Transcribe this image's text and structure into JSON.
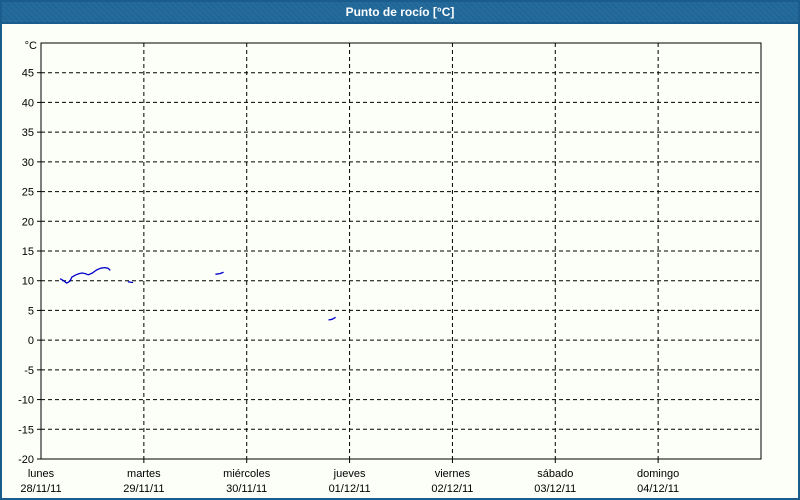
{
  "window": {
    "title": "Punto de rocío [°C]",
    "title_bar_color": "#20689a",
    "border_color": "#1a5c8c",
    "background_color": "#fcfef8"
  },
  "chart_data": {
    "type": "line",
    "title": "Punto de rocío [°C]",
    "grid": "dashed-black",
    "legend_position": "none",
    "y_axis": {
      "unit_label": "°C",
      "min": -20,
      "max": 50,
      "tick_step": 5,
      "tick_labels": [
        45,
        40,
        35,
        30,
        25,
        20,
        15,
        10,
        5,
        0,
        -5,
        -10,
        -15,
        -20
      ]
    },
    "x_axis": {
      "unit": "day",
      "days": [
        {
          "name": "lunes",
          "date": "28/11/11"
        },
        {
          "name": "martes",
          "date": "29/11/11"
        },
        {
          "name": "miércoles",
          "date": "30/11/11"
        },
        {
          "name": "jueves",
          "date": "01/12/11"
        },
        {
          "name": "viernes",
          "date": "02/12/11"
        },
        {
          "name": "domingo",
          "date": "04/12/11"
        }
      ],
      "days_full": [
        {
          "name": "lunes",
          "date": "28/11/11"
        },
        {
          "name": "martes",
          "date": "29/11/11"
        },
        {
          "name": "miércoles",
          "date": "30/11/11"
        },
        {
          "name": "jueves",
          "date": "01/12/11"
        },
        {
          "name": "viernes",
          "date": "02/12/11"
        },
        {
          "name": "sábado",
          "date": "03/12/11"
        },
        {
          "name": "domingo",
          "date": "04/12/11"
        }
      ]
    },
    "series": [
      {
        "name": "punto de rocío",
        "color": "#0000cc",
        "x_unit": "days_from_28/11/11 (fraction = hour/24)",
        "segments": [
          [
            [
              0.19,
              10.3
            ],
            [
              0.22,
              10.0
            ],
            [
              0.25,
              9.6
            ],
            [
              0.28,
              9.9
            ],
            [
              0.3,
              10.6
            ],
            [
              0.34,
              11.0
            ],
            [
              0.37,
              11.2
            ],
            [
              0.4,
              11.3
            ],
            [
              0.43,
              11.2
            ],
            [
              0.46,
              11.0
            ],
            [
              0.5,
              11.3
            ],
            [
              0.54,
              11.8
            ],
            [
              0.58,
              12.1
            ],
            [
              0.62,
              12.2
            ],
            [
              0.65,
              12.1
            ],
            [
              0.67,
              11.8
            ]
          ],
          [
            [
              0.85,
              9.8
            ],
            [
              0.89,
              9.7
            ]
          ],
          [
            [
              1.7,
              11.1
            ],
            [
              1.74,
              11.2
            ],
            [
              1.77,
              11.4
            ]
          ],
          [
            [
              2.8,
              3.4
            ],
            [
              2.83,
              3.5
            ],
            [
              2.86,
              3.8
            ]
          ]
        ]
      }
    ]
  }
}
